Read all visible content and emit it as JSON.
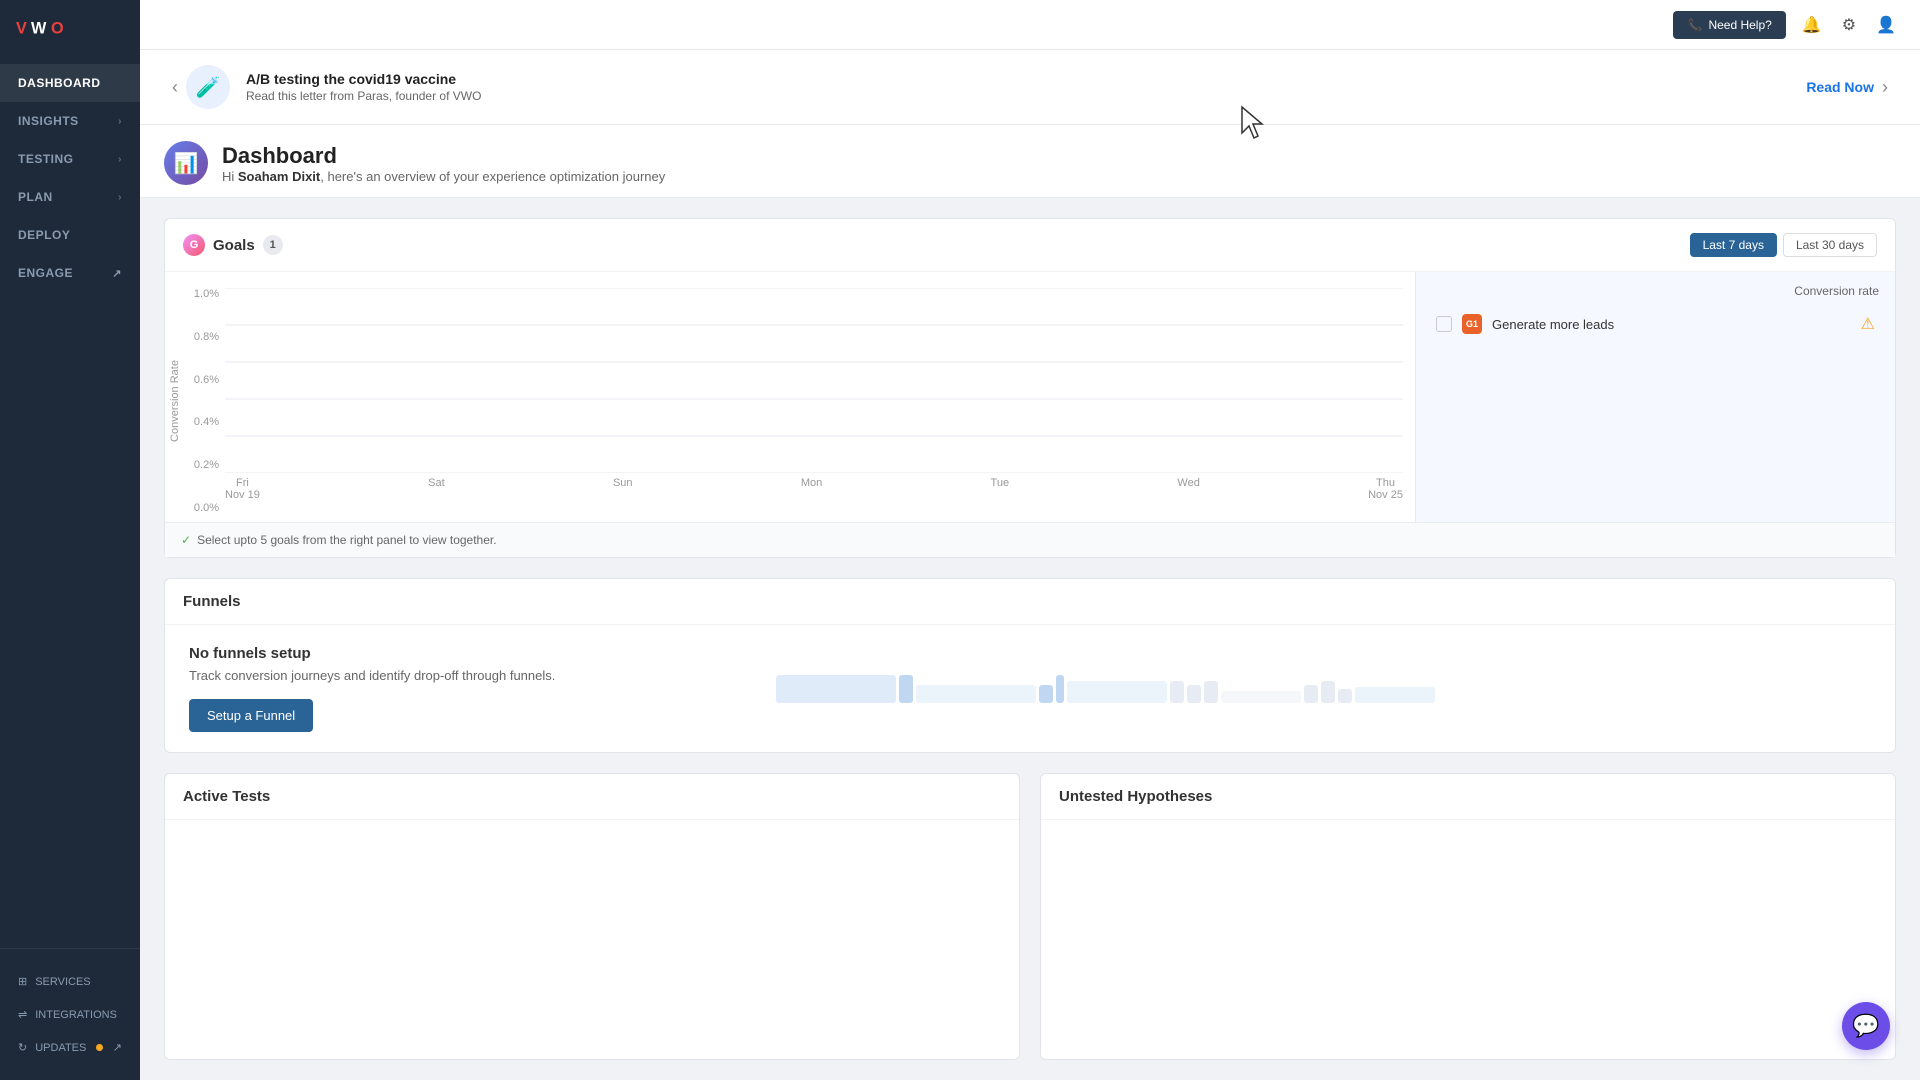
{
  "sidebar": {
    "logo": "VWO",
    "nav_items": [
      {
        "id": "dashboard",
        "label": "DASHBOARD",
        "active": true,
        "has_chevron": false
      },
      {
        "id": "insights",
        "label": "INSIGHTS",
        "active": false,
        "has_chevron": true
      },
      {
        "id": "testing",
        "label": "TESTING",
        "active": false,
        "has_chevron": true
      },
      {
        "id": "plan",
        "label": "PLAN",
        "active": false,
        "has_chevron": true
      },
      {
        "id": "deploy",
        "label": "DEPLOY",
        "active": false,
        "has_chevron": false
      },
      {
        "id": "engage",
        "label": "ENGAGE",
        "active": false,
        "has_chevron": false
      }
    ],
    "bottom_items": [
      {
        "id": "services",
        "label": "SERVICES",
        "icon": "grid"
      },
      {
        "id": "integrations",
        "label": "INTEGRATIONS",
        "icon": "link"
      },
      {
        "id": "updates",
        "label": "UPDATES",
        "icon": "refresh",
        "has_badge": true
      }
    ]
  },
  "topbar": {
    "need_help_label": "Need Help?",
    "icons": [
      "bell-plus",
      "settings",
      "user"
    ]
  },
  "notification": {
    "title": "A/B testing the covid19 vaccine",
    "subtitle": "Read this letter from Paras, founder of VWO",
    "read_now_label": "Read Now"
  },
  "dashboard": {
    "title": "Dashboard",
    "greeting_prefix": "Hi ",
    "user_name": "Soaham Dixit",
    "greeting_suffix": ", here's an overview of your experience optimization journey"
  },
  "goals": {
    "section_title": "Goals",
    "badge_count": "1",
    "date_buttons": [
      {
        "label": "Last 7 days",
        "active": true
      },
      {
        "label": "Last 30 days",
        "active": false
      }
    ],
    "y_axis_labels": [
      "1.0%",
      "0.8%",
      "0.6%",
      "0.4%",
      "0.2%",
      "0.0%"
    ],
    "x_axis_labels": [
      {
        "day": "Fri",
        "date": "Nov 19"
      },
      {
        "day": "Sat",
        "date": ""
      },
      {
        "day": "Sun",
        "date": ""
      },
      {
        "day": "Mon",
        "date": ""
      },
      {
        "day": "Tue",
        "date": ""
      },
      {
        "day": "Wed",
        "date": ""
      },
      {
        "day": "Thu",
        "date": "Nov 25"
      }
    ],
    "y_axis_title": "Conversion Rate",
    "conversion_rate_header": "Conversion rate",
    "goal_rows": [
      {
        "id": "G1",
        "name": "Generate more leads",
        "has_warning": true
      }
    ],
    "chart_note": "Select upto 5 goals from the right panel to view together."
  },
  "funnels": {
    "section_title": "Funnels",
    "empty_title": "No funnels setup",
    "empty_sub": "Track conversion journeys and identify drop-off through funnels.",
    "setup_btn_label": "Setup a Funnel"
  },
  "active_tests": {
    "section_title": "Active Tests"
  },
  "untested_hypotheses": {
    "section_title": "Untested Hypotheses"
  },
  "chat": {
    "icon": "💬"
  }
}
